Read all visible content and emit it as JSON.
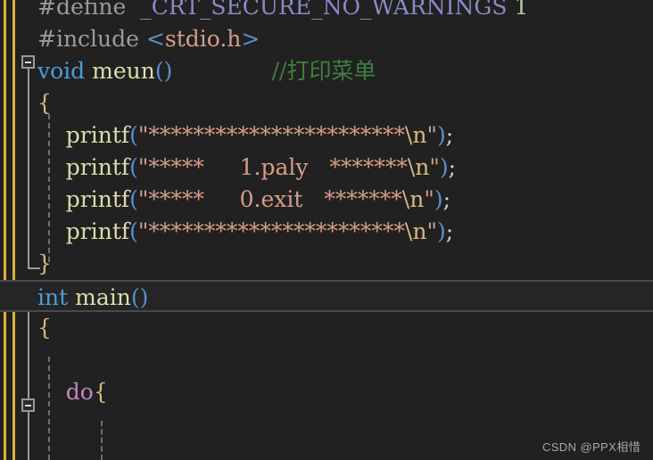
{
  "editor": {
    "theme_name": "dark",
    "background_color": "#212121",
    "current_line_background": "#252525",
    "change_bar_color": "#d8b53a",
    "gutter_fold_color": "#9a9a9a",
    "indent_guide_color": "#6e6e6e"
  },
  "colors": {
    "preprocessor": "#9b9b9b",
    "macro_name": "#8a8ac8",
    "number": "#b5cea8",
    "keyword_type": "#4a9cd6",
    "keyword_control": "#c586c0",
    "function_name": "#dcdcaa",
    "parenthesis": "#5a8fc8",
    "brace": "#d7ba7d",
    "string": "#d69d85",
    "escape": "#d7ba7d",
    "comment": "#3f7f3f",
    "plain": "#d4d4d4"
  },
  "code": {
    "language": "C",
    "lines": [
      {
        "id": "line-define",
        "clipped_top": true,
        "tokens": [
          {
            "kind": "preprocessor",
            "text": "#define"
          },
          {
            "kind": "plain",
            "text": "  "
          },
          {
            "kind": "macro_name",
            "text": "_CRT_SECURE_NO_WARNINGS"
          },
          {
            "kind": "plain",
            "text": " "
          },
          {
            "kind": "number",
            "text": "1"
          }
        ]
      },
      {
        "id": "line-include",
        "tokens": [
          {
            "kind": "preprocessor",
            "text": "#include"
          },
          {
            "kind": "plain",
            "text": " "
          },
          {
            "kind": "parenthesis",
            "text": "<"
          },
          {
            "kind": "string",
            "text": "stdio.h"
          },
          {
            "kind": "parenthesis",
            "text": ">"
          }
        ]
      },
      {
        "id": "line-void-meun",
        "fold": "open",
        "tokens": [
          {
            "kind": "keyword_type",
            "text": "void"
          },
          {
            "kind": "plain",
            "text": " "
          },
          {
            "kind": "function_name",
            "text": "meun"
          },
          {
            "kind": "parenthesis",
            "text": "()"
          },
          {
            "kind": "plain",
            "text": "              "
          },
          {
            "kind": "comment",
            "text": "//打印菜单"
          }
        ]
      },
      {
        "id": "line-meun-open-brace",
        "tokens": [
          {
            "kind": "brace",
            "text": "{"
          }
        ]
      },
      {
        "id": "line-printf-1",
        "tokens": [
          {
            "kind": "plain",
            "text": "    "
          },
          {
            "kind": "function_name",
            "text": "printf"
          },
          {
            "kind": "parenthesis",
            "text": "("
          },
          {
            "kind": "string",
            "text": "\"***********************"
          },
          {
            "kind": "escape",
            "text": "\\n"
          },
          {
            "kind": "string",
            "text": "\""
          },
          {
            "kind": "parenthesis",
            "text": ")"
          },
          {
            "kind": "plain",
            "text": ";"
          }
        ]
      },
      {
        "id": "line-printf-2",
        "tokens": [
          {
            "kind": "plain",
            "text": "    "
          },
          {
            "kind": "function_name",
            "text": "printf"
          },
          {
            "kind": "parenthesis",
            "text": "("
          },
          {
            "kind": "string",
            "text": "\"*****     1.paly   *******"
          },
          {
            "kind": "escape",
            "text": "\\n"
          },
          {
            "kind": "string",
            "text": "\""
          },
          {
            "kind": "parenthesis",
            "text": ")"
          },
          {
            "kind": "plain",
            "text": ";"
          }
        ]
      },
      {
        "id": "line-printf-3",
        "tokens": [
          {
            "kind": "plain",
            "text": "    "
          },
          {
            "kind": "function_name",
            "text": "printf"
          },
          {
            "kind": "parenthesis",
            "text": "("
          },
          {
            "kind": "string",
            "text": "\"*****     0.exit   *******"
          },
          {
            "kind": "escape",
            "text": "\\n"
          },
          {
            "kind": "string",
            "text": "\""
          },
          {
            "kind": "parenthesis",
            "text": ")"
          },
          {
            "kind": "plain",
            "text": ";"
          }
        ]
      },
      {
        "id": "line-printf-4",
        "tokens": [
          {
            "kind": "plain",
            "text": "    "
          },
          {
            "kind": "function_name",
            "text": "printf"
          },
          {
            "kind": "parenthesis",
            "text": "("
          },
          {
            "kind": "string",
            "text": "\"***********************"
          },
          {
            "kind": "escape",
            "text": "\\n"
          },
          {
            "kind": "string",
            "text": "\""
          },
          {
            "kind": "parenthesis",
            "text": ")"
          },
          {
            "kind": "plain",
            "text": ";"
          }
        ]
      },
      {
        "id": "line-meun-close-brace",
        "tokens": [
          {
            "kind": "brace",
            "text": "}"
          }
        ]
      },
      {
        "id": "line-int-main",
        "fold": "open",
        "current": true,
        "tokens": [
          {
            "kind": "keyword_type",
            "text": "int"
          },
          {
            "kind": "plain",
            "text": " "
          },
          {
            "kind": "function_name",
            "text": "main"
          },
          {
            "kind": "parenthesis",
            "text": "()"
          }
        ]
      },
      {
        "id": "line-main-open-brace",
        "tokens": [
          {
            "kind": "brace",
            "text": "{"
          }
        ]
      },
      {
        "id": "line-blank-1",
        "tokens": []
      },
      {
        "id": "line-do",
        "fold": "open",
        "tokens": [
          {
            "kind": "plain",
            "text": "    "
          },
          {
            "kind": "keyword_control",
            "text": "do"
          },
          {
            "kind": "brace",
            "text": "{"
          }
        ]
      },
      {
        "id": "line-clipped-bottom",
        "clipped_bottom": true,
        "tokens": []
      }
    ]
  },
  "watermark": {
    "text": "CSDN @PPX相惜"
  }
}
